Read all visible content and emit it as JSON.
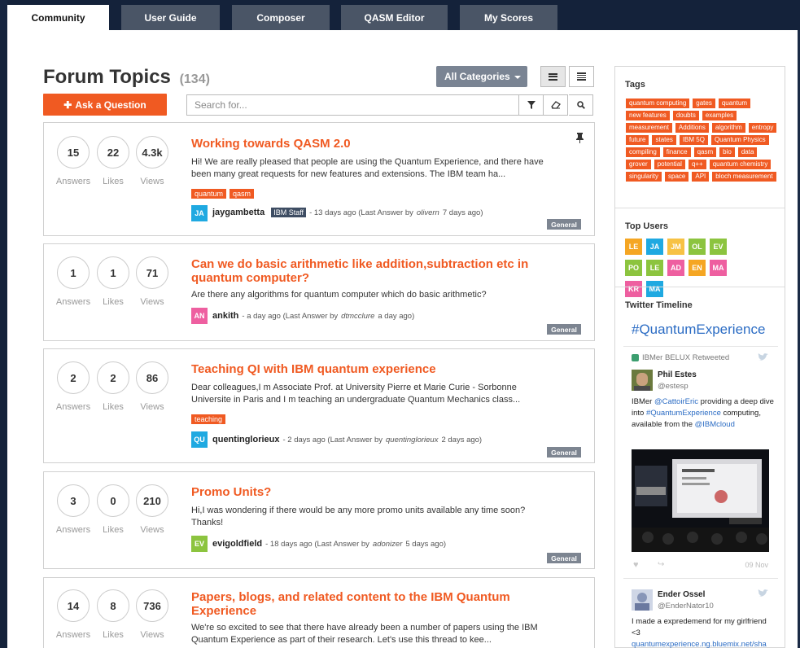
{
  "nav": {
    "tabs": [
      {
        "label": "Community",
        "active": true
      },
      {
        "label": "User Guide",
        "active": false
      },
      {
        "label": "Composer",
        "active": false
      },
      {
        "label": "QASM Editor",
        "active": false
      },
      {
        "label": "My Scores",
        "active": false
      }
    ]
  },
  "header": {
    "title": "Forum Topics",
    "count": "(134)",
    "category_filter": "All Categories",
    "ask_label": "Ask a Question",
    "search_placeholder": "Search for..."
  },
  "stat_labels": {
    "answers": "Answers",
    "likes": "Likes",
    "views": "Views"
  },
  "topics": [
    {
      "answers": "15",
      "likes": "22",
      "views": "4.3k",
      "title": "Working towards QASM 2.0",
      "excerpt": "Hi! We are really pleased that people are using the Quantum Experience, and there have been many great requests for new features and extensions. The IBM team ha...",
      "tags": [
        "quantum",
        "qasm"
      ],
      "avatar": "JA",
      "avatar_color": "#1fa9e1",
      "user": "jaygambetta",
      "staff": "IBM Staff",
      "time": "- 13 days ago (Last Answer by",
      "last_user": "olivern",
      "last_time": "7 days ago)",
      "category": "General",
      "pinned": true
    },
    {
      "answers": "1",
      "likes": "1",
      "views": "71",
      "title": "Can we do basic arithmetic like addition,subtraction etc in quantum computer?",
      "excerpt": "Are there any algorithms for quantum computer which do basic arithmetic?",
      "tags": [],
      "avatar": "AN",
      "avatar_color": "#ee5fa0",
      "user": "ankith",
      "staff": "",
      "time": "- a day ago (Last Answer by",
      "last_user": "dtmcclure",
      "last_time": "a day ago)",
      "category": "General",
      "pinned": false
    },
    {
      "answers": "2",
      "likes": "2",
      "views": "86",
      "title": "Teaching QI with IBM quantum experience",
      "excerpt": "Dear colleagues,I m Associate Prof. at University Pierre et Marie Curie - Sorbonne Universite in Paris and I m teaching an undergraduate Quantum Mechanics class...",
      "tags": [
        "teaching"
      ],
      "avatar": "QU",
      "avatar_color": "#1fa9e1",
      "user": "quentinglorieux",
      "staff": "",
      "time": "- 2 days ago (Last Answer by",
      "last_user": "quentinglorieux",
      "last_time": "2 days ago)",
      "category": "General",
      "pinned": false
    },
    {
      "answers": "3",
      "likes": "0",
      "views": "210",
      "title": "Promo Units?",
      "excerpt": "Hi,I was wondering if there would be any more promo units available any time soon? Thanks!",
      "tags": [],
      "avatar": "EV",
      "avatar_color": "#8cc43f",
      "user": "evigoldfield",
      "staff": "",
      "time": "- 18 days ago (Last Answer by",
      "last_user": "adonizer",
      "last_time": "5 days ago)",
      "category": "General",
      "pinned": false
    },
    {
      "answers": "14",
      "likes": "8",
      "views": "736",
      "title": "Papers, blogs, and related content to the IBM Quantum Experience",
      "excerpt": "We're so excited to see that there have already been a number of papers using the IBM Quantum Experience as part of their research. Let's use this thread to kee...",
      "tags": [],
      "avatar": "",
      "avatar_color": "#1fa9e1",
      "user": "",
      "staff": "",
      "time": "",
      "last_user": "",
      "last_time": "",
      "category": "",
      "pinned": false
    }
  ],
  "sidebar": {
    "tags_heading": "Tags",
    "tags": [
      "quantum computing",
      "gates",
      "quantum",
      "new features",
      "doubts",
      "examples",
      "measurement",
      "Additions",
      "algorithm",
      "entropy",
      "future",
      "states",
      "IBM 5Q",
      "Quantum Physics",
      "compiling",
      "finance",
      "qasm",
      "bio",
      "data",
      "grover",
      "potential",
      "q++",
      "quantum chemistry",
      "singularity",
      "space",
      "API",
      "bloch measurement"
    ],
    "users_heading": "Top Users",
    "users": [
      {
        "initials": "LE",
        "color": "#f5a623"
      },
      {
        "initials": "JA",
        "color": "#1fa9e1"
      },
      {
        "initials": "JM",
        "color": "#f7c244"
      },
      {
        "initials": "OL",
        "color": "#8cc43f"
      },
      {
        "initials": "EV",
        "color": "#8cc43f"
      },
      {
        "initials": "PO",
        "color": "#8cc43f"
      },
      {
        "initials": "LE",
        "color": "#8cc43f"
      },
      {
        "initials": "AD",
        "color": "#ee5fa0"
      },
      {
        "initials": "EN",
        "color": "#f5a623"
      },
      {
        "initials": "MA",
        "color": "#ee5fa0"
      },
      {
        "initials": "KR",
        "color": "#ee5fa0"
      },
      {
        "initials": "MA",
        "color": "#1fa9e1"
      }
    ],
    "twitter_heading": "Twitter Timeline",
    "hashtag": "#QuantumExperience",
    "retweet_label": "IBMer BELUX Retweeted",
    "tweet1": {
      "name": "Phil Estes",
      "handle": "@estesp",
      "text_a": "IBMer ",
      "link_a": "@CattoirEric",
      "text_b": " providing a deep dive into ",
      "link_b": "#QuantumExperience",
      "text_c": " computing, available from the ",
      "link_c": "@IBMcloud",
      "date": "09 Nov"
    },
    "tweet2": {
      "name": "Ender Ossel",
      "handle": "@EnderNator10",
      "text": "I made a expredemend for my girlfriend <3",
      "link": "quantumexperience.ng.bluemix.net/sha"
    }
  }
}
